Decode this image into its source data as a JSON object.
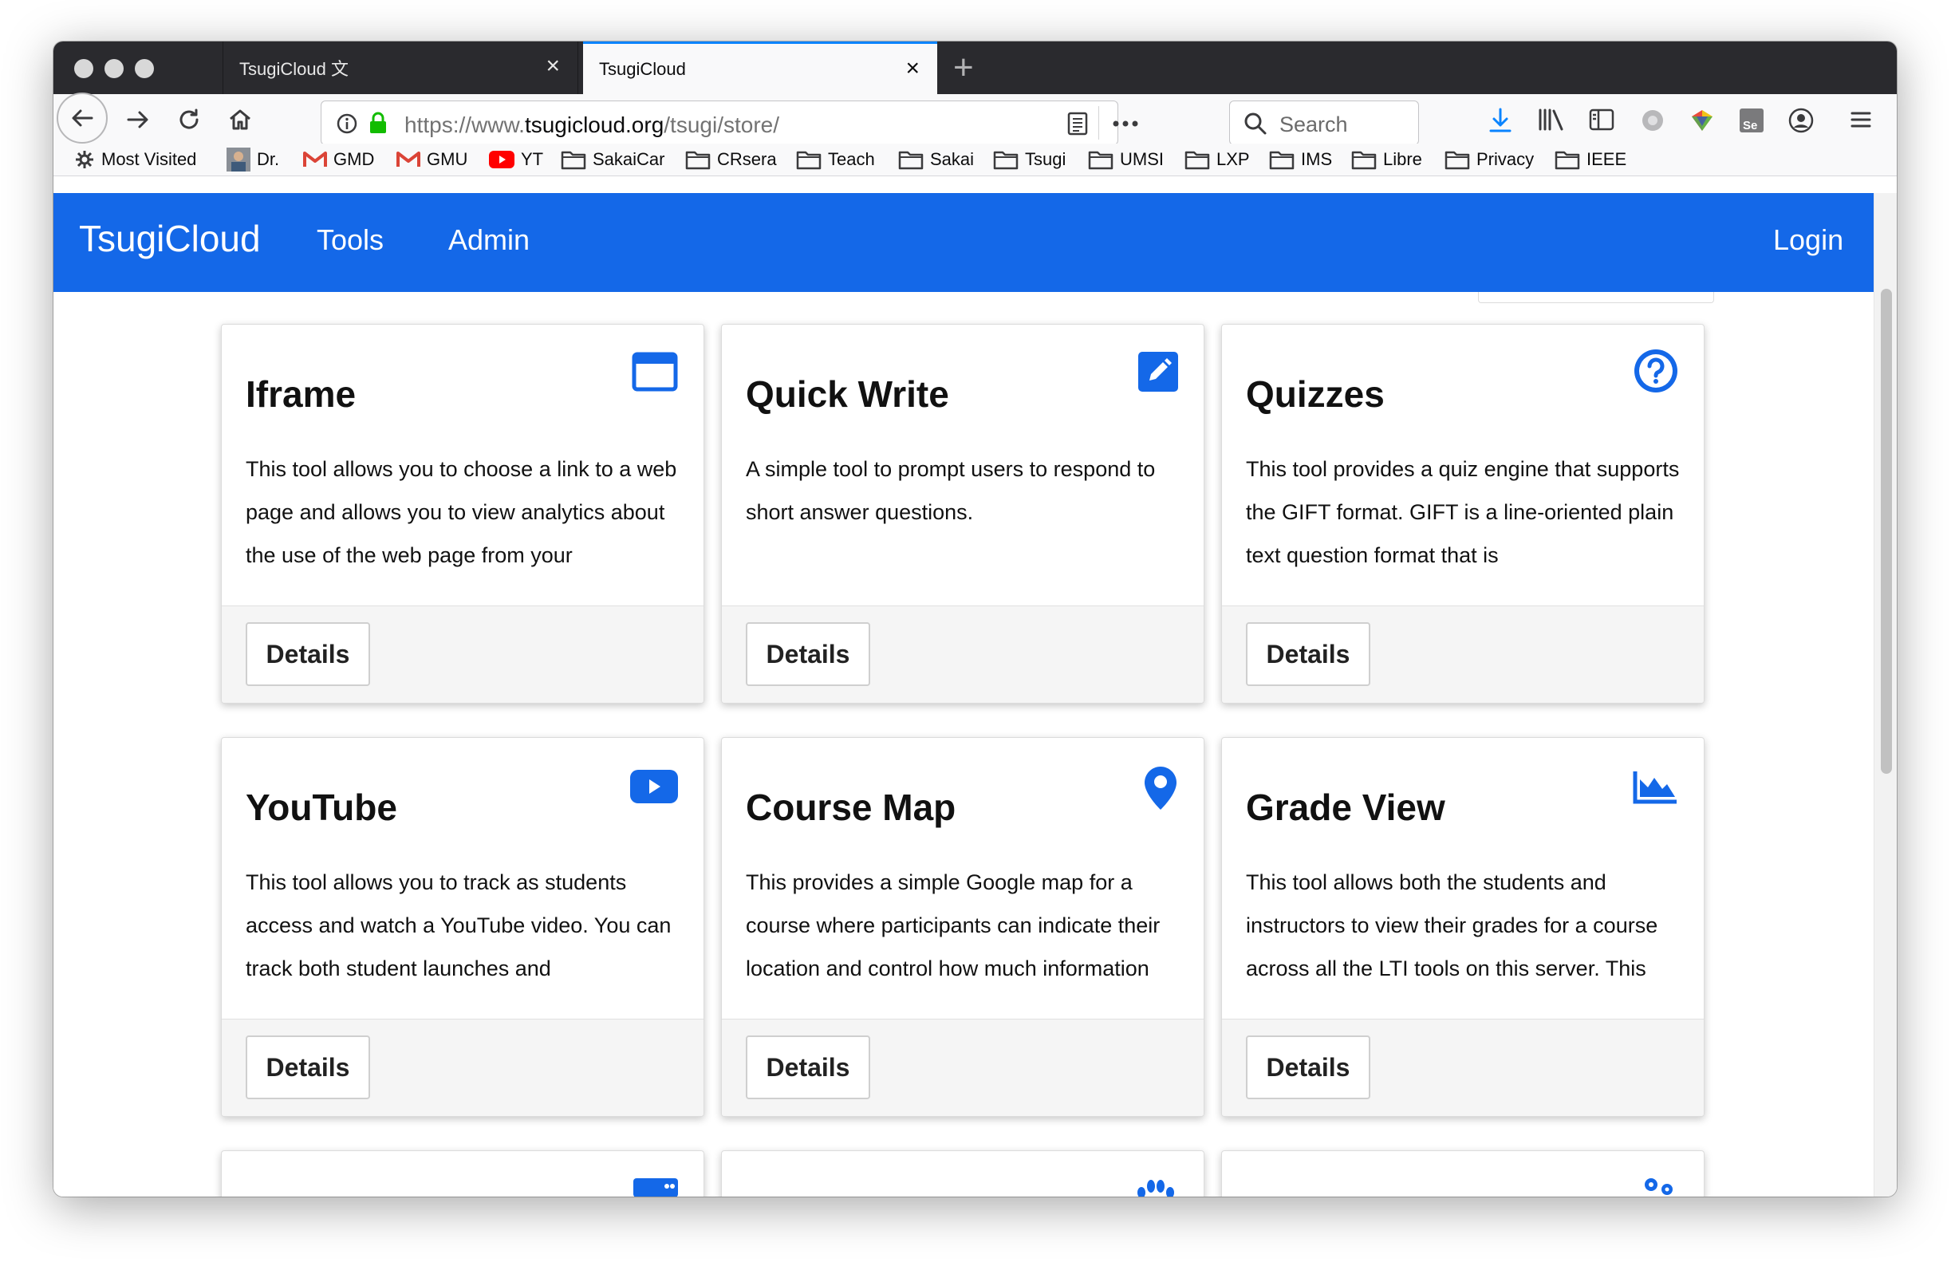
{
  "browser": {
    "tabs": [
      {
        "title": "TsugiCloud 文"
      },
      {
        "title": "TsugiCloud"
      }
    ],
    "url": {
      "prefix": "https://www.",
      "host": "tsugicloud.org",
      "path": "/tsugi/store/"
    },
    "search_placeholder": "Search",
    "bookmarks": [
      {
        "label": "Most Visited",
        "icon": "gear-icon"
      },
      {
        "label": "Dr.",
        "icon": "avatar-icon"
      },
      {
        "label": "GMD",
        "icon": "gmail-icon"
      },
      {
        "label": "GMU",
        "icon": "gmail-icon"
      },
      {
        "label": "YT",
        "icon": "youtube-icon"
      },
      {
        "label": "SakaiCar",
        "icon": "folder-icon"
      },
      {
        "label": "CRsera",
        "icon": "folder-icon"
      },
      {
        "label": "Teach",
        "icon": "folder-icon"
      },
      {
        "label": "Sakai",
        "icon": "folder-icon"
      },
      {
        "label": "Tsugi",
        "icon": "folder-icon"
      },
      {
        "label": "UMSI",
        "icon": "folder-icon"
      },
      {
        "label": "LXP",
        "icon": "folder-icon"
      },
      {
        "label": "IMS",
        "icon": "folder-icon"
      },
      {
        "label": "Libre",
        "icon": "folder-icon"
      },
      {
        "label": "Privacy",
        "icon": "folder-icon"
      },
      {
        "label": "IEEE",
        "icon": "folder-icon"
      }
    ],
    "accent": "#0a84ff"
  },
  "site": {
    "brand": "TsugiCloud",
    "nav": {
      "tools": "Tools",
      "admin": "Admin",
      "login": "Login"
    },
    "navbar_color": "#1468e8"
  },
  "cards": [
    {
      "title": "Iframe",
      "icon": "window-icon",
      "description": "This tool allows you to choose a link to a web page and allows you to view analytics about the use of the web page from your",
      "button": "Details"
    },
    {
      "title": "Quick Write",
      "icon": "pencil-square-icon",
      "description": "A simple tool to prompt users to respond to short answer questions.",
      "button": "Details"
    },
    {
      "title": "Quizzes",
      "icon": "question-circle-icon",
      "description": "This tool provides a quiz engine that supports the GIFT format. GIFT is a line-oriented plain text question format that is",
      "button": "Details"
    },
    {
      "title": "YouTube",
      "icon": "youtube-play-icon",
      "description": "This tool allows you to track as students access and watch a YouTube video. You can track both student launches and",
      "button": "Details"
    },
    {
      "title": "Course Map",
      "icon": "map-marker-icon",
      "description": "This provides a simple Google map for a course where participants can indicate their location and control how much information",
      "button": "Details"
    },
    {
      "title": "Grade View",
      "icon": "area-chart-icon",
      "description": "This tool allows both the students and instructors to view their grades for a course across all the LTI tools on this server. This",
      "button": "Details"
    }
  ]
}
